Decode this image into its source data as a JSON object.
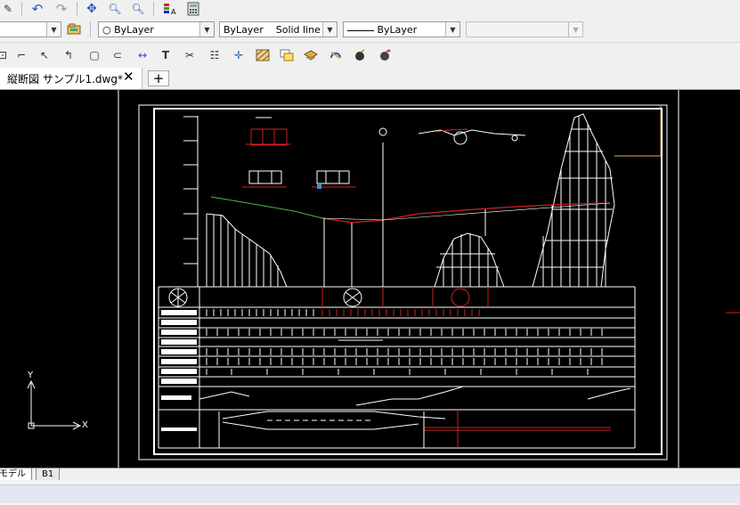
{
  "toolbar1": {
    "icons": [
      "pencil-icon",
      "undo-icon",
      "redo-icon",
      "pan-icon",
      "zoom-realtime-icon",
      "zoom-window-icon",
      "properties-icon",
      "calculator-icon"
    ]
  },
  "toolbar2": {
    "layer_combo_value": "",
    "color_combo_value": "ByLayer",
    "linetype_layer": "ByLayer",
    "linetype_name": "Solid line",
    "lineweight_value": "ByLayer",
    "plotstyle_value": ""
  },
  "toolbar3": {
    "icons": [
      "dimension-icon",
      "arc-dim-icon",
      "radius-dim-icon",
      "jogged-dim-icon",
      "center-dim-icon",
      "continue-dim-icon",
      "text-icon",
      "leader-icon",
      "table-icon",
      "coordinate-icon",
      "hatch-icon",
      "block-icon",
      "layer-icon",
      "rotate-icon",
      "bomb-icon",
      "explode-icon"
    ]
  },
  "document": {
    "tab_label": "縦断図 サンプル1.dwg*",
    "close_glyph": "✕",
    "new_tab_glyph": "+"
  },
  "layout_tabs": [
    "モデル",
    "B1"
  ],
  "ucs": {
    "x_label": "X",
    "y_label": "Y"
  },
  "colors": {
    "canvas_bg": "#000000",
    "paper": "#ffffff",
    "profile_red": "#d42020",
    "ground_green": "#44bb44",
    "ui_bg": "#f0f0f0"
  }
}
